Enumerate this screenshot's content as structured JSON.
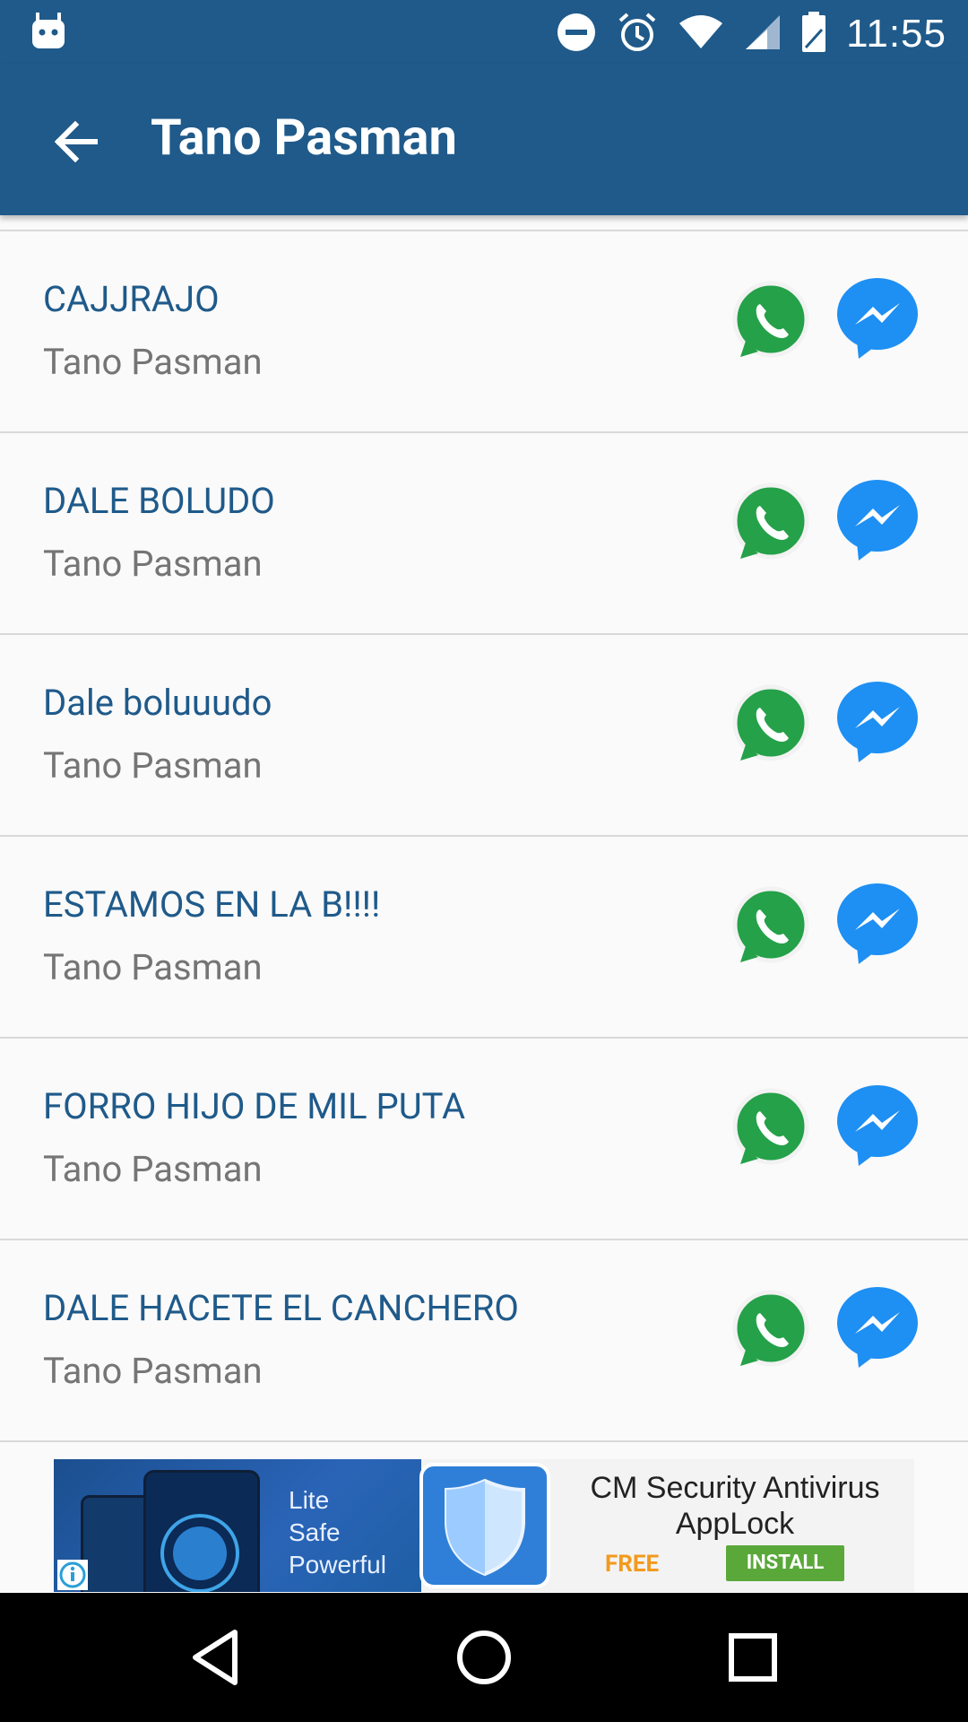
{
  "status_bar": {
    "time": "11:55",
    "icons": [
      "android-robot-icon",
      "do-not-disturb-icon",
      "alarm-icon",
      "wifi-icon",
      "signal-icon",
      "battery-icon"
    ]
  },
  "app_bar": {
    "title": "Tano Pasman",
    "back_icon": "back-arrow-icon"
  },
  "list": {
    "items": [
      {
        "title": "CAJJRAJO",
        "subtitle": "Tano Pasman"
      },
      {
        "title": "DALE BOLUDO",
        "subtitle": "Tano Pasman"
      },
      {
        "title": "Dale boluuudo",
        "subtitle": "Tano Pasman"
      },
      {
        "title": "ESTAMOS EN LA B!!!!",
        "subtitle": "Tano Pasman"
      },
      {
        "title": "FORRO HIJO DE MIL PUTA",
        "subtitle": "Tano Pasman"
      },
      {
        "title": "DALE HACETE EL CANCHERO",
        "subtitle": "Tano Pasman"
      }
    ],
    "share_icons": [
      "whatsapp-icon",
      "messenger-icon"
    ]
  },
  "ad": {
    "promo_lines": [
      "Lite",
      "Safe",
      "Powerful"
    ],
    "app_name": "CM Security Antivirus AppLock",
    "price": "FREE",
    "cta": "INSTALL"
  },
  "nav_bar": {
    "icons": [
      "back-triangle-icon",
      "home-circle-icon",
      "recents-square-icon"
    ]
  },
  "colors": {
    "primary": "#1f5a8a",
    "whatsapp": "#25a149",
    "messenger": "#1e8ff3",
    "divider": "#d9d9d9"
  }
}
